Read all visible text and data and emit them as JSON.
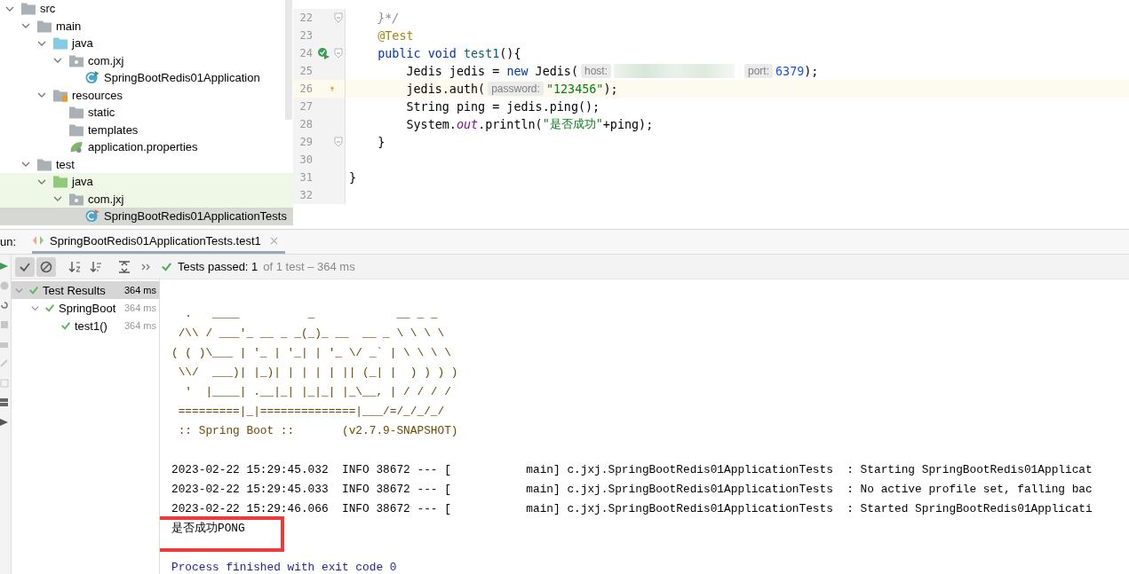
{
  "project_tree": [
    {
      "name": "src",
      "kind": "folder",
      "expanded": true,
      "selected": false,
      "children": [
        {
          "name": "main",
          "kind": "folder",
          "expanded": true,
          "selected": false,
          "children": [
            {
              "name": "java",
              "kind": "source-folder",
              "expanded": true,
              "selected": false,
              "children": [
                {
                  "name": "com.jxj",
                  "kind": "package",
                  "expanded": true,
                  "selected": false,
                  "children": [
                    {
                      "name": "SpringBootRedis01Application",
                      "kind": "spring-class",
                      "selected": false
                    }
                  ]
                }
              ]
            },
            {
              "name": "resources",
              "kind": "resources-folder",
              "expanded": true,
              "selected": false,
              "children": [
                {
                  "name": "static",
                  "kind": "folder",
                  "selected": false
                },
                {
                  "name": "templates",
                  "kind": "folder",
                  "selected": false
                },
                {
                  "name": "application.properties",
                  "kind": "spring-properties",
                  "selected": false
                }
              ]
            }
          ]
        },
        {
          "name": "test",
          "kind": "folder",
          "expanded": true,
          "selected": false,
          "children": [
            {
              "name": "java",
              "kind": "test-folder",
              "expanded": true,
              "selected": false,
              "highlighted": true,
              "children": [
                {
                  "name": "com.jxj",
                  "kind": "package",
                  "expanded": true,
                  "selected": false,
                  "highlighted": true,
                  "children": [
                    {
                      "name": "SpringBootRedis01ApplicationTests",
                      "kind": "test-class",
                      "selected": true
                    }
                  ]
                }
              ]
            }
          ]
        }
      ]
    }
  ],
  "editor": {
    "lines": [
      {
        "number": "22",
        "current": false,
        "kind": "plain",
        "fold": true,
        "tokens": [
          {
            "kind": "comment",
            "text": "    }*/"
          }
        ]
      },
      {
        "number": "23",
        "current": false,
        "kind": "plain",
        "fold": false,
        "tokens": [
          {
            "kind": "annotation",
            "text": "    @Test"
          }
        ]
      },
      {
        "number": "24",
        "current": false,
        "kind": "run",
        "fold": true,
        "tokens": [
          {
            "kind": "keyword",
            "text": "    public "
          },
          {
            "kind": "keyword",
            "text": "void "
          },
          {
            "kind": "declaration",
            "text": "test1"
          },
          {
            "kind": "plain",
            "text": "(){"
          }
        ]
      },
      {
        "number": "25",
        "current": false,
        "kind": "plain",
        "fold": false,
        "tokens": [
          {
            "kind": "plain",
            "text": "        Jedis jedis = "
          },
          {
            "kind": "keyword",
            "text": "new"
          },
          {
            "kind": "plain",
            "text": " Jedis("
          },
          {
            "kind": "hint",
            "text": "host:"
          },
          {
            "kind": "redacted"
          },
          {
            "kind": "hint",
            "text": "port:"
          },
          {
            "kind": "number",
            "text": "6379"
          },
          {
            "kind": "plain",
            "text": ");"
          }
        ]
      },
      {
        "number": "26",
        "current": true,
        "kind": "bulb",
        "fold": false,
        "tokens": [
          {
            "kind": "plain",
            "text": "        jedis.auth("
          },
          {
            "kind": "hint",
            "text": "password:"
          },
          {
            "kind": "string",
            "text": "\"123456\""
          },
          {
            "kind": "plain",
            "text": ");"
          }
        ]
      },
      {
        "number": "27",
        "current": false,
        "kind": "plain",
        "fold": false,
        "tokens": [
          {
            "kind": "plain",
            "text": "        String ping = jedis.ping();"
          }
        ]
      },
      {
        "number": "28",
        "current": false,
        "kind": "plain",
        "fold": false,
        "tokens": [
          {
            "kind": "plain",
            "text": "        System."
          },
          {
            "kind": "field",
            "text": "out"
          },
          {
            "kind": "plain",
            "text": ".println("
          },
          {
            "kind": "string",
            "text": "\"是否成功\""
          },
          {
            "kind": "plain",
            "text": "+ping);"
          }
        ]
      },
      {
        "number": "29",
        "current": false,
        "kind": "plain",
        "fold": true,
        "tokens": [
          {
            "kind": "plain",
            "text": "    }"
          }
        ]
      },
      {
        "number": "30",
        "current": false,
        "kind": "plain",
        "fold": false
      },
      {
        "number": "31",
        "current": false,
        "kind": "plain",
        "fold": false,
        "tokens": [
          {
            "kind": "plain",
            "text": "}"
          }
        ]
      },
      {
        "number": "32",
        "current": false,
        "kind": "plain",
        "fold": false
      }
    ]
  },
  "run_panel": {
    "label": "un:",
    "tabs": [
      {
        "label": "SpringBootRedis01ApplicationTests.test1",
        "selected": true
      }
    ],
    "toolbar": {
      "buttons": [
        {
          "kind": "show-passed",
          "on": true
        },
        {
          "kind": "show-ignored",
          "on": true
        },
        {
          "kind": "sort-alpha",
          "on": false
        },
        {
          "kind": "sort-duration",
          "on": false
        },
        {
          "kind": "expand-all",
          "on": false
        },
        {
          "kind": "more",
          "on": false
        }
      ],
      "status": "Tests passed: ",
      "passed_count": "1",
      "detail": "of 1 test – 364 ms"
    },
    "test_tree": [
      {
        "name": "Test Results",
        "time": "364 ms",
        "selected": true,
        "children": [
          {
            "name": "SpringBoot",
            "time": "364 ms",
            "selected": false,
            "children": [
              {
                "name": "test1()",
                "time": "364 ms",
                "selected": false
              }
            ]
          }
        ]
      }
    ],
    "console": {
      "banner": [
        "  .   ____          _            __ _ _",
        " /\\\\ / ___'_ __ _ _(_)_ __  __ _ \\ \\ \\ \\",
        "( ( )\\___ | '_ | '_| | '_ \\/ _` | \\ \\ \\ \\",
        " \\\\/  ___)| |_)| | | | | || (_| |  ) ) ) )",
        "  '  |____| .__|_| |_|_| |_\\__, | / / / /",
        " =========|_|==============|___/=/_/_/_/",
        " :: Spring Boot ::       (v2.7.9-SNAPSHOT)"
      ],
      "logs": [
        "2023-02-22 15:29:45.032  INFO 38672 --- [           main] c.jxj.SpringBootRedis01ApplicationTests  : Starting SpringBootRedis01Applicat",
        "2023-02-22 15:29:45.033  INFO 38672 --- [           main] c.jxj.SpringBootRedis01ApplicationTests  : No active profile set, falling bac",
        "2023-02-22 15:29:46.066  INFO 38672 --- [           main] c.jxj.SpringBootRedis01ApplicationTests  : Started SpringBootRedis01Applicati"
      ],
      "output": "是否成功PONG",
      "exit": "Process finished with exit code 0"
    }
  }
}
